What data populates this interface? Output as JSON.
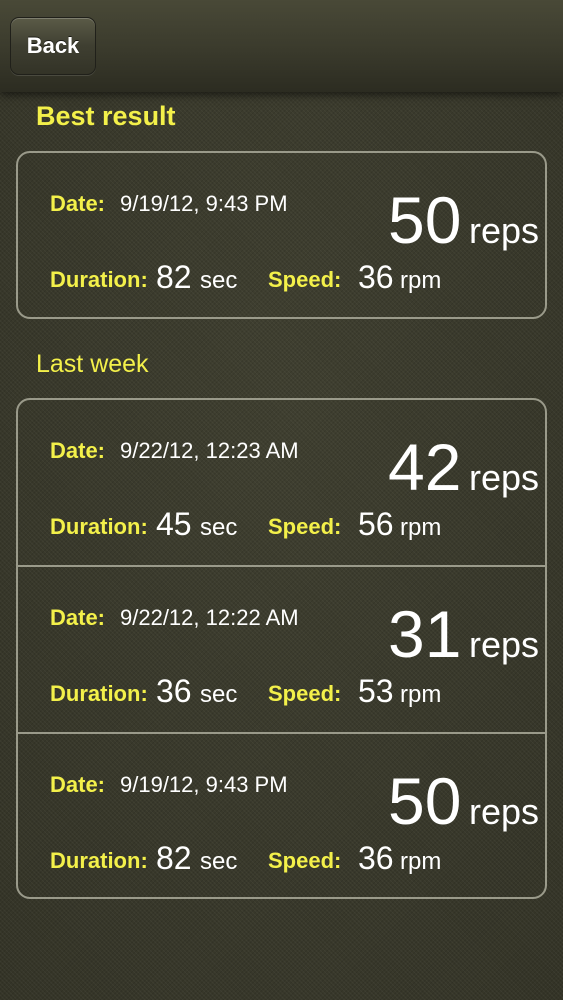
{
  "header": {
    "back_label": "Back"
  },
  "best": {
    "title": "Best result",
    "entry": {
      "date_label": "Date:",
      "date": "9/19/12, 9:43 PM",
      "reps": "50",
      "reps_unit": "reps",
      "duration_label": "Duration:",
      "duration": "82",
      "duration_unit": "sec",
      "speed_label": "Speed:",
      "speed": "36",
      "speed_unit": "rpm"
    }
  },
  "last_week": {
    "title": "Last week",
    "entries": [
      {
        "date_label": "Date:",
        "date": "9/22/12, 12:23 AM",
        "reps": "42",
        "reps_unit": "reps",
        "duration_label": "Duration:",
        "duration": "45",
        "duration_unit": "sec",
        "speed_label": "Speed:",
        "speed": "56",
        "speed_unit": "rpm"
      },
      {
        "date_label": "Date:",
        "date": "9/22/12, 12:22 AM",
        "reps": "31",
        "reps_unit": "reps",
        "duration_label": "Duration:",
        "duration": "36",
        "duration_unit": "sec",
        "speed_label": "Speed:",
        "speed": "53",
        "speed_unit": "rpm"
      },
      {
        "date_label": "Date:",
        "date": "9/19/12, 9:43 PM",
        "reps": "50",
        "reps_unit": "reps",
        "duration_label": "Duration:",
        "duration": "82",
        "duration_unit": "sec",
        "speed_label": "Speed:",
        "speed": "36",
        "speed_unit": "rpm"
      }
    ]
  },
  "colors": {
    "label": "#f3f04a",
    "value": "#ffffff",
    "background": "#3a3a2b",
    "border": "#9a9a8a"
  }
}
